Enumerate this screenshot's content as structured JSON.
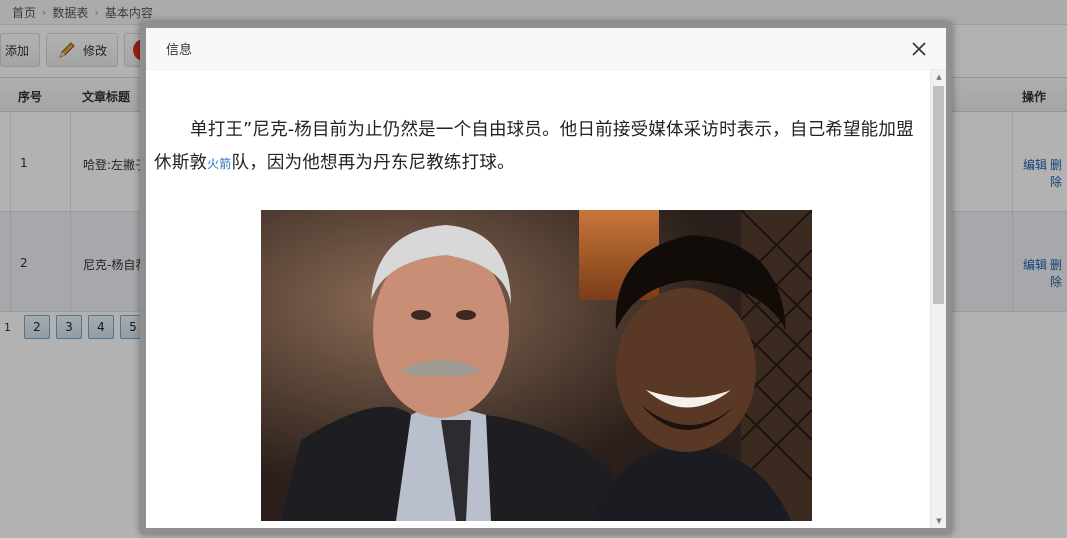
{
  "breadcrumb": {
    "items": [
      "首页",
      "数据表",
      "基本内容"
    ]
  },
  "toolbar": {
    "add_label": "添加",
    "edit_label": "修改"
  },
  "table": {
    "headers": {
      "index": "序号",
      "title": "文章标题",
      "actions": "操作"
    },
    "rows": [
      {
        "index": "1",
        "title": "哈登:左撇子",
        "edit": "编辑",
        "delete": "删除"
      },
      {
        "index": "2",
        "title": "尼克-杨自荐",
        "edit": "编辑",
        "delete": "删除"
      }
    ]
  },
  "pager": {
    "current": "1",
    "pages": [
      "2",
      "3",
      "4",
      "5"
    ]
  },
  "modal": {
    "title": "信息",
    "paragraph_part1": "单打王”尼克-杨目前为止仍然是一个自由球员。他日前接受媒体采访时表示，自己希望能加盟休斯敦",
    "keyword_link": "火箭",
    "paragraph_part2": "队，因为他想再为丹东尼教练打球。"
  },
  "icons": {
    "close": "close-icon",
    "edit": "pencil-icon",
    "delete": "delete-icon"
  },
  "colors": {
    "link": "#1e5fa8",
    "delete_icon": "#d9301e",
    "row_alt": "#eef1f7"
  }
}
